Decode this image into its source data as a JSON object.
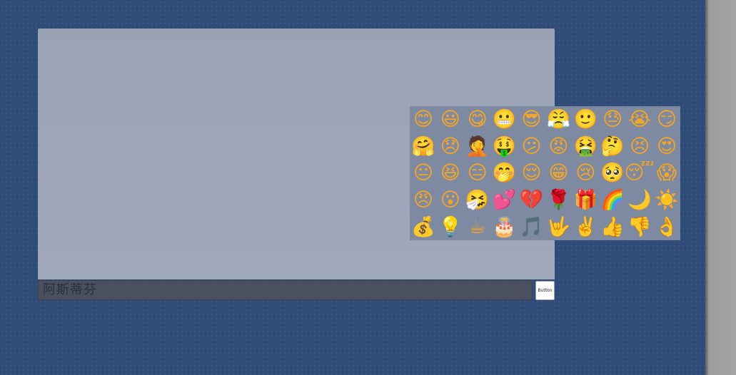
{
  "composer": {
    "input_value": "阿斯蒂芬",
    "send_label": "Button"
  },
  "emoji_picker": {
    "rows": [
      [
        {
          "name": "smile-icon",
          "glyph": "😊"
        },
        {
          "name": "grin-icon",
          "glyph": "😃"
        },
        {
          "name": "tongue-out-icon",
          "glyph": "😋"
        },
        {
          "name": "awkward-icon",
          "glyph": "😬"
        },
        {
          "name": "sunglasses-icon",
          "glyph": "😎"
        },
        {
          "name": "angry-teeth-icon",
          "glyph": "😤"
        },
        {
          "name": "shy-smile-icon",
          "glyph": "🙂"
        },
        {
          "name": "sweat-icon",
          "glyph": "😓"
        },
        {
          "name": "cry-icon",
          "glyph": "😭"
        },
        {
          "name": "smirk-icon",
          "glyph": "😏"
        }
      ],
      [
        {
          "name": "hug-icon",
          "glyph": "🤗"
        },
        {
          "name": "sad-icon",
          "glyph": "😞"
        },
        {
          "name": "facepalm-icon",
          "glyph": "🤦"
        },
        {
          "name": "money-eyes-icon",
          "glyph": "🤑"
        },
        {
          "name": "confused-question-icon",
          "glyph": "😕"
        },
        {
          "name": "blush-angry-icon",
          "glyph": "😡"
        },
        {
          "name": "vomit-icon",
          "glyph": "🤮"
        },
        {
          "name": "thinking-icon",
          "glyph": "🤔"
        },
        {
          "name": "pouting-icon",
          "glyph": "😣"
        },
        {
          "name": "heart-eyes-icon",
          "glyph": "😍"
        }
      ],
      [
        {
          "name": "expressionless-icon",
          "glyph": "😐"
        },
        {
          "name": "laughing-icon",
          "glyph": "😆"
        },
        {
          "name": "squint-icon",
          "glyph": "😑"
        },
        {
          "name": "covering-face-icon",
          "glyph": "🤭"
        },
        {
          "name": "relieved-icon",
          "glyph": "😌"
        },
        {
          "name": "grimace-icon",
          "glyph": "😁"
        },
        {
          "name": "sob-icon",
          "glyph": "😢"
        },
        {
          "name": "pleading-icon",
          "glyph": "🥺"
        },
        {
          "name": "sleepy-icon",
          "glyph": "😴"
        },
        {
          "name": "scream-icon",
          "glyph": "😱"
        }
      ],
      [
        {
          "name": "furious-icon",
          "glyph": "😠"
        },
        {
          "name": "shocked-icon",
          "glyph": "😮"
        },
        {
          "name": "sneezing-icon",
          "glyph": "🤧"
        },
        {
          "name": "hearts-icon",
          "glyph": "💕"
        },
        {
          "name": "broken-heart-icon",
          "glyph": "💔"
        },
        {
          "name": "rose-icon",
          "glyph": "🌹"
        },
        {
          "name": "gift-icon",
          "glyph": "🎁"
        },
        {
          "name": "rainbow-icon",
          "glyph": "🌈"
        },
        {
          "name": "moon-night-icon",
          "glyph": "🌙"
        },
        {
          "name": "sun-icon",
          "glyph": "☀️"
        }
      ],
      [
        {
          "name": "coins-icon",
          "glyph": "💰"
        },
        {
          "name": "lightbulb-icon",
          "glyph": "💡"
        },
        {
          "name": "coffee-icon",
          "glyph": "☕"
        },
        {
          "name": "cake-icon",
          "glyph": "🎂"
        },
        {
          "name": "music-notes-icon",
          "glyph": "🎵"
        },
        {
          "name": "rock-hand-icon",
          "glyph": "🤟"
        },
        {
          "name": "victory-hand-icon",
          "glyph": "✌️"
        },
        {
          "name": "thumbs-up-icon",
          "glyph": "👍"
        },
        {
          "name": "thumbs-down-icon",
          "glyph": "👎"
        },
        {
          "name": "ok-hand-icon",
          "glyph": "👌"
        }
      ]
    ]
  }
}
